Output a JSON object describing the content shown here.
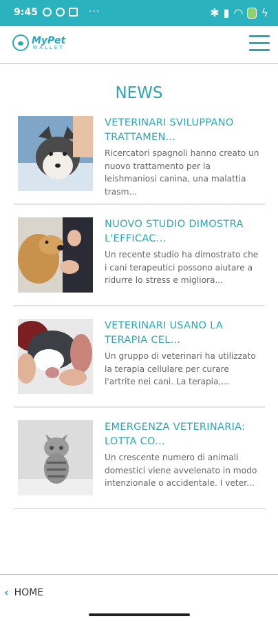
{
  "status": {
    "time": "9:45"
  },
  "header": {
    "logo_top": "MyPet",
    "logo_bottom": "WALLET"
  },
  "page": {
    "title": "NEWS"
  },
  "news": [
    {
      "title": "VETERINARI SVILUPPANO TRATTAMEN...",
      "desc": "Ricercatori spagnoli hanno creato un nuovo trattamento per la leishmaniosi canina, una malattia trasm...",
      "image": "husky-at-vet"
    },
    {
      "title": "NUOVO STUDIO DIMOSTRA L'EFFICAC...",
      "desc": "Un recente studio ha dimostrato che i cani terapeutici possono aiutare a ridurre lo stress e migliora...",
      "image": "golden-retriever-therapy"
    },
    {
      "title": "VETERINARI USANO LA TERAPIA CEL...",
      "desc": "Un gruppo di veterinari ha utilizzato la terapia cellulare per curare l'artrite nei cani. La terapia,...",
      "image": "dog-being-held"
    },
    {
      "title": "EMERGENZA VETERINARIA: LOTTA CO...",
      "desc": "Un crescente numero di animali domestici viene avvelenato in modo intenzionale o accidentale. I veter...",
      "image": "tabby-kitten"
    }
  ],
  "bottom": {
    "home_label": "HOME"
  }
}
